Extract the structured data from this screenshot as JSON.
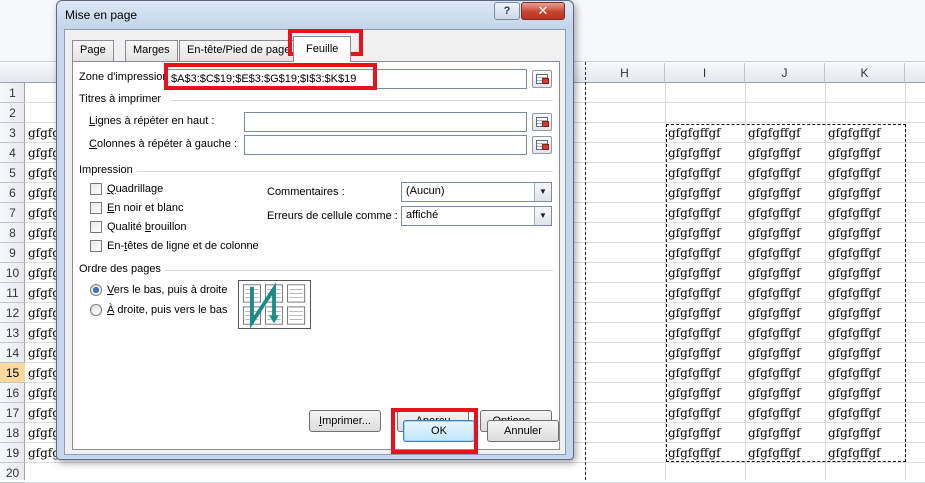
{
  "spreadsheet": {
    "columns": [
      "H",
      "I",
      "J",
      "K"
    ],
    "rows": [
      "1",
      "2",
      "3",
      "4",
      "5",
      "6",
      "7",
      "8",
      "9",
      "10",
      "11",
      "12",
      "13",
      "14",
      "15",
      "16",
      "17",
      "18",
      "19",
      "20"
    ],
    "active_row": "15",
    "cell_value": "gfgfgffgf",
    "left_cell_value": "gfgfgff"
  },
  "dialog": {
    "title": "Mise en page",
    "help_label": "?",
    "close_label": "✕",
    "tabs": [
      {
        "label": "Page",
        "active": false
      },
      {
        "label": "Marges",
        "active": false
      },
      {
        "label": "En-tête/Pied de page",
        "active": false
      },
      {
        "label": "Feuille",
        "active": true
      }
    ],
    "print_area": {
      "label": "Zone d'impression",
      "value": "$A$3:$C$19;$E$3:$G$19;$I$3:$K$19"
    },
    "titles_group": "Titres à imprimer",
    "rows_repeat": {
      "label_prefix": "L",
      "label_rest": "ignes à répéter en haut :",
      "value": ""
    },
    "cols_repeat": {
      "label_prefix": "C",
      "label_rest": "olonnes à répéter à gauche :",
      "value": ""
    },
    "print_group": "Impression",
    "checkboxes": [
      {
        "prefix": "Q",
        "rest": "uadrillage"
      },
      {
        "prefix": "E",
        "rest": "n noir et blanc"
      },
      {
        "pre": "Qualité ",
        "prefix": "b",
        "rest": "rouillon"
      },
      {
        "pre": "En-",
        "prefix": "t",
        "rest": "êtes de ligne et de colonne"
      }
    ],
    "comments": {
      "label": "Commentaires :",
      "value": "(Aucun)"
    },
    "cell_errors": {
      "label": "Erreurs de cellule comme :",
      "value": "affiché"
    },
    "order_group": "Ordre des pages",
    "radios": [
      {
        "prefix": "V",
        "rest": "ers le bas, puis à droite",
        "checked": true
      },
      {
        "prefix": "À",
        "rest": " droite, puis vers le bas",
        "checked": false
      }
    ],
    "buttons": {
      "print": {
        "prefix": "I",
        "rest": "mprimer..."
      },
      "preview": {
        "pre": "Aper",
        "prefix": "ç",
        "rest": "u"
      },
      "options": {
        "prefix": "O",
        "rest": "ptions..."
      },
      "ok": "OK",
      "cancel": "Annuler"
    }
  }
}
